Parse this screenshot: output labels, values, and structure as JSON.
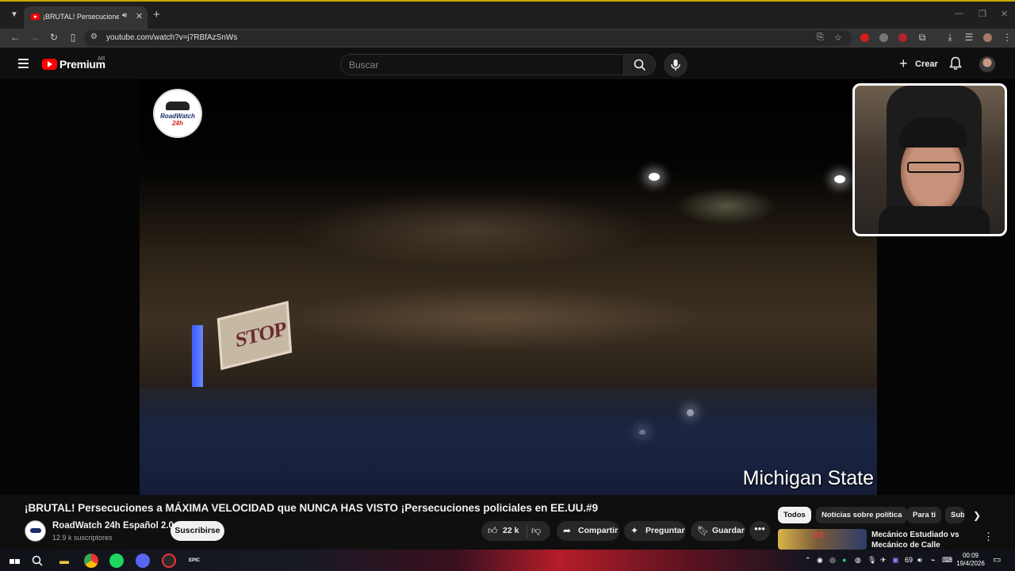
{
  "browser": {
    "tab_title": "¡BRUTAL! Persecuciones a MÁXIMA VELOCIDAD que NUNCA HAS VISTO",
    "url": "youtube.com/watch?v=j7RBfAzSnWs"
  },
  "header": {
    "logo_text": "Premium",
    "country_code": "AR",
    "search_placeholder": "Buscar",
    "create_label": "Crear"
  },
  "video": {
    "watermark_line1": "RoadWatch",
    "watermark_line2": "24h",
    "overlay_caption": "Michigan State",
    "sign_text": "STOP"
  },
  "details": {
    "title": "¡BRUTAL! Persecuciones a MÁXIMA VELOCIDAD que NUNCA HAS VISTO ¡Persecuciones policiales en EE.UU.#9",
    "channel_name": "RoadWatch 24h Español 2.0",
    "subscribers": "12.9 k suscriptores",
    "subscribe_label": "Suscribirse",
    "likes": "22 k",
    "share_label": "Compartir",
    "ask_label": "Preguntar",
    "save_label": "Guardar",
    "more_label": "•••"
  },
  "recommendations": {
    "chips": [
      "Todos",
      "Noticias sobre política",
      "Para ti",
      "Sub"
    ],
    "active_chip": "Todos",
    "first_title": "Mecánico Estudiado vs Mecánico de Calle",
    "thumb_text": "VS"
  },
  "taskbar": {
    "battery_or_volume": "69",
    "time": "00:09",
    "date": "19/4/2026",
    "epic_label": "EPIC"
  },
  "colors": {
    "youtube_red": "#ff0000",
    "background": "#0f0f0f",
    "pill": "#272727"
  },
  "icons": [
    "menu-icon",
    "search-icon",
    "mic-icon",
    "bell-icon",
    "like-icon",
    "dislike-icon",
    "share-icon",
    "sparkle-icon",
    "bookmark-icon",
    "windows-icon",
    "chrome-icon",
    "spotify-icon",
    "discord-icon"
  ]
}
